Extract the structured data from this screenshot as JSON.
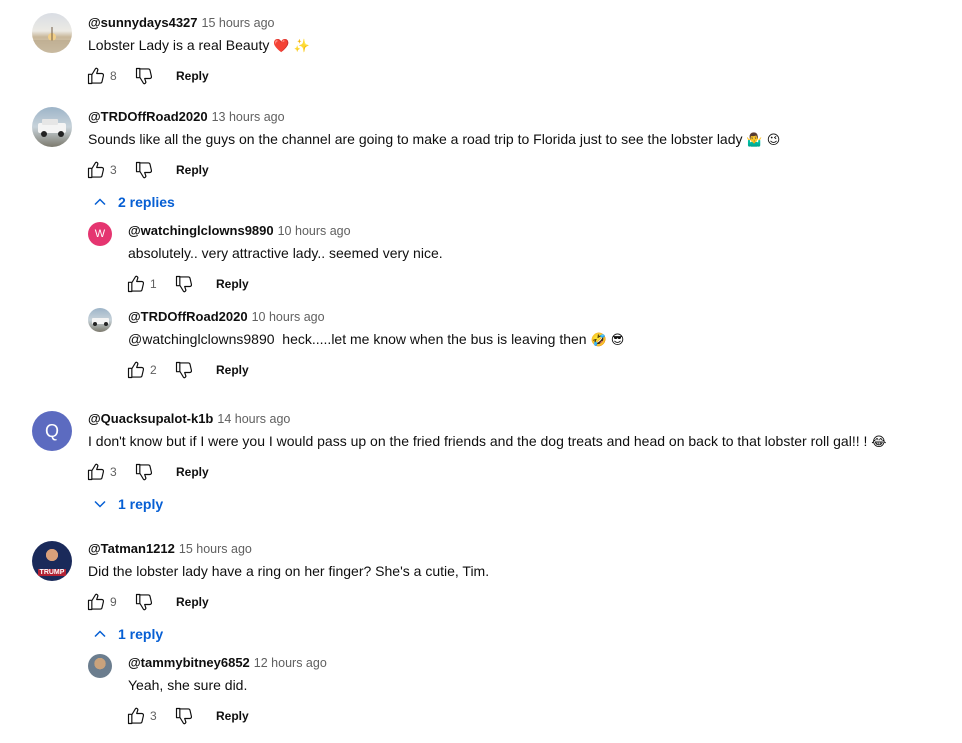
{
  "comments": [
    {
      "author": "@sunnydays4327",
      "time": "15 hours ago",
      "text": "Lobster Lady is a real Beauty",
      "emoji": "❤️ ✨",
      "likes": "8",
      "reply_label": "Reply"
    },
    {
      "author": "@TRDOffRoad2020",
      "time": "13 hours ago",
      "text": "Sounds like all the guys on the channel are going to make a road trip to Florida just to see the lobster lady",
      "emoji": "🤷‍♂️ 😉",
      "likes": "3",
      "reply_label": "Reply",
      "toggle_label": "2 replies",
      "replies": [
        {
          "author": "@watchinglclowns9890",
          "time": "10 hours ago",
          "text": "absolutely.. very attractive lady.. seemed very nice.",
          "likes": "1",
          "reply_label": "Reply",
          "avatar_letter": "W",
          "avatar_color": "#e53570"
        },
        {
          "author": "@TRDOffRoad2020",
          "time": "10 hours ago",
          "text": "@watchinglclowns9890  heck.....let me know when the bus is leaving then",
          "emoji": "🤣 😎",
          "likes": "2",
          "reply_label": "Reply"
        }
      ]
    },
    {
      "author": "@Quacksupalot-k1b",
      "time": "14 hours ago",
      "text": "I don't know but if I were you I would pass up on the fried friends and the dog treats and head on back to that lobster roll gal!! !",
      "emoji": "😂",
      "likes": "3",
      "reply_label": "Reply",
      "toggle_label": "1 reply",
      "avatar_letter": "Q",
      "avatar_color": "#5c6bc0"
    },
    {
      "author": "@Tatman1212",
      "time": "15 hours ago",
      "text": "Did the lobster lady have a ring on her finger? She's a cutie, Tim.",
      "likes": "9",
      "reply_label": "Reply",
      "toggle_label": "1 reply",
      "avatar_text": "TRUMP",
      "replies": [
        {
          "author": "@tammybitney6852",
          "time": "12 hours ago",
          "text": "Yeah, she sure did.",
          "likes": "3",
          "reply_label": "Reply"
        }
      ]
    }
  ],
  "colors": {
    "link_blue": "#065fd4",
    "meta_gray": "#606060",
    "text": "#0f0f0f"
  }
}
